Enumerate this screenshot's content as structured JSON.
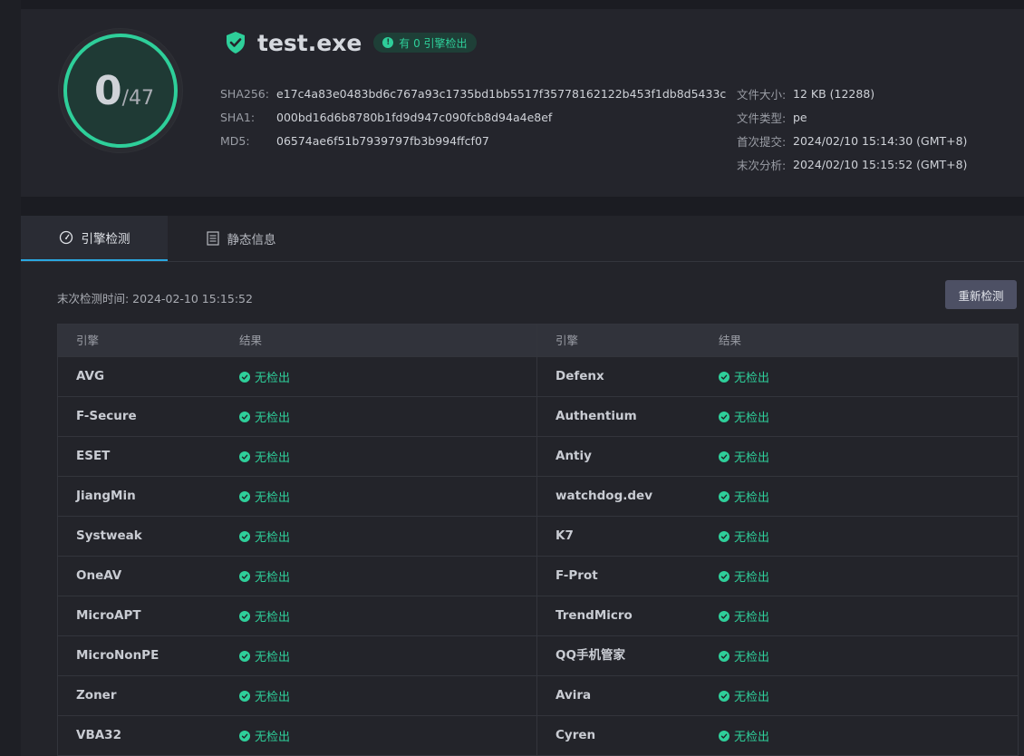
{
  "score": {
    "detected": "0",
    "total": "/47"
  },
  "file": {
    "name": "test.exe",
    "status": "有 0 引擎检出"
  },
  "hashes": [
    {
      "key": "SHA256:",
      "value": "e17c4a83e0483bd6c767a93c1735bd1bb5517f35778162122b453f1db8d5433c"
    },
    {
      "key": "SHA1:",
      "value": "000bd16d6b8780b1fd9d947c090fcb8d94a4e8ef"
    },
    {
      "key": "MD5:",
      "value": "06574ae6f51b7939797fb3b994ffcf07"
    }
  ],
  "meta": [
    {
      "key": "文件大小:",
      "value": "12 KB (12288)"
    },
    {
      "key": "文件类型:",
      "value": "pe"
    },
    {
      "key": "首次提交:",
      "value": "2024/02/10 15:14:30 (GMT+8)"
    },
    {
      "key": "末次分析:",
      "value": "2024/02/10 15:15:52 (GMT+8)"
    }
  ],
  "tabs": [
    {
      "label": "引擎检测",
      "icon": "gauge-icon"
    },
    {
      "label": "静态信息",
      "icon": "document-icon"
    }
  ],
  "toolbar": {
    "last_scan": "末次检测时间: 2024-02-10 15:15:52",
    "recheck_label": "重新检测"
  },
  "table": {
    "headers": [
      "引擎",
      "结果",
      "引擎",
      "结果"
    ],
    "rows": [
      {
        "left": "AVG",
        "left_result": "无检出",
        "right": "Defenx",
        "right_result": "无检出"
      },
      {
        "left": "F-Secure",
        "left_result": "无检出",
        "right": "Authentium",
        "right_result": "无检出"
      },
      {
        "left": "ESET",
        "left_result": "无检出",
        "right": "Antiy",
        "right_result": "无检出"
      },
      {
        "left": "JiangMin",
        "left_result": "无检出",
        "right": "watchdog.dev",
        "right_result": "无检出"
      },
      {
        "left": "Systweak",
        "left_result": "无检出",
        "right": "K7",
        "right_result": "无检出"
      },
      {
        "left": "OneAV",
        "left_result": "无检出",
        "right": "F-Prot",
        "right_result": "无检出"
      },
      {
        "left": "MicroAPT",
        "left_result": "无检出",
        "right": "TrendMicro",
        "right_result": "无检出"
      },
      {
        "left": "MicroNonPE",
        "left_result": "无检出",
        "right": "QQ手机管家",
        "right_result": "无检出"
      },
      {
        "left": "Zoner",
        "left_result": "无检出",
        "right": "Avira",
        "right_result": "无检出"
      },
      {
        "left": "VBA32",
        "left_result": "无检出",
        "right": "Cyren",
        "right_result": "无检出"
      }
    ]
  },
  "colors": {
    "accent": "#2ecf9a",
    "tab_underline": "#2aa7e0",
    "button_bg": "#4d5064"
  }
}
